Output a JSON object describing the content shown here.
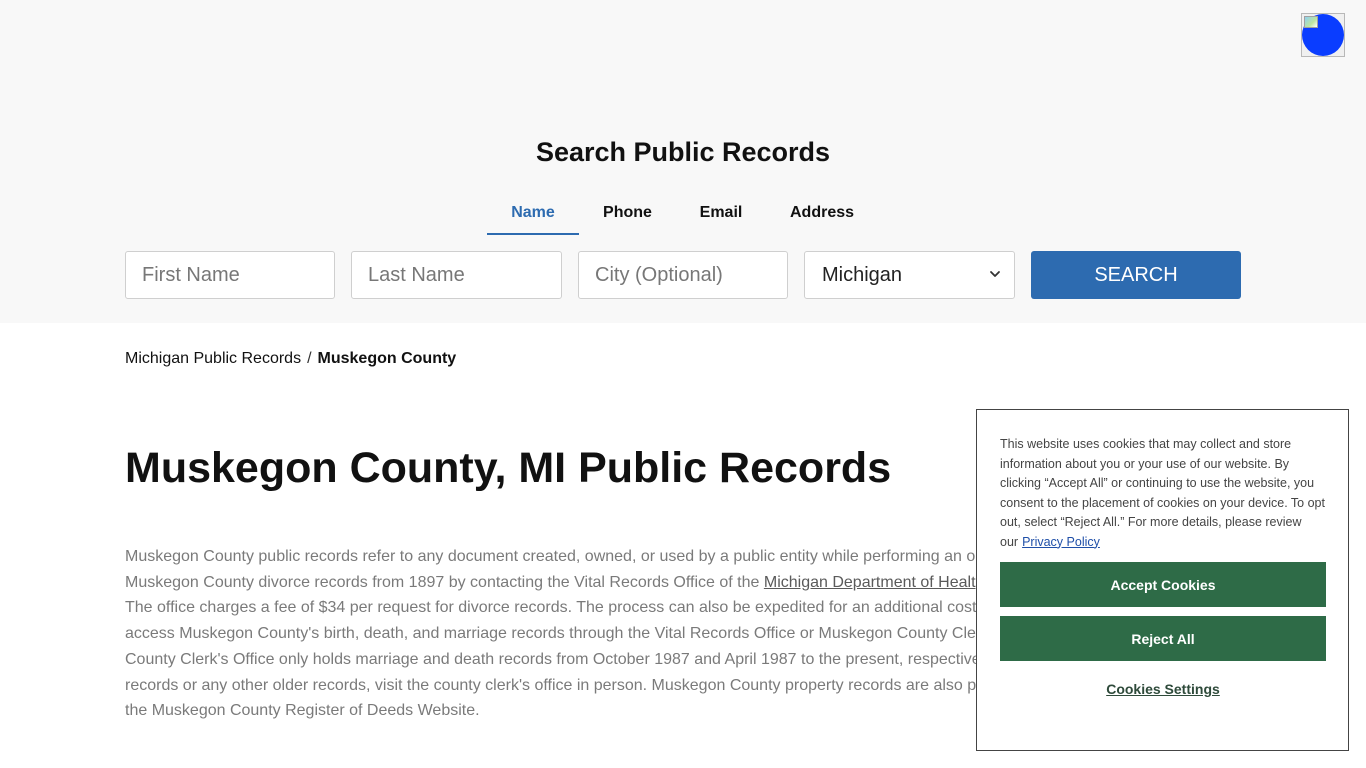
{
  "colors": {
    "accent": "#2d6bb0",
    "search_band": "#f8f8f8",
    "cookie_button": "#2e6b47",
    "avatar": "#0a3dff"
  },
  "search": {
    "title": "Search Public Records",
    "tabs": [
      {
        "label": "Name",
        "active": true
      },
      {
        "label": "Phone",
        "active": false
      },
      {
        "label": "Email",
        "active": false
      },
      {
        "label": "Address",
        "active": false
      }
    ],
    "first_name_placeholder": "First Name",
    "last_name_placeholder": "Last Name",
    "city_placeholder": "City (Optional)",
    "state_selected": "Michigan",
    "button_label": "SEARCH"
  },
  "breadcrumb": {
    "parent": "Michigan Public Records",
    "separator": "/",
    "current": "Muskegon County"
  },
  "page": {
    "title": "Muskegon County, MI Public Records",
    "lines": [
      {
        "text": "Muskegon County public records refer to any document created, owned, or used by a public entity while performing an o"
      },
      {
        "before": "Muskegon County divorce records from 1897 by contacting the Vital Records Office of the ",
        "link": "Michigan Department of Healt"
      },
      {
        "text": "The office charges a fee of $34 per request for divorce records. The process can also be expedited for an additional cost"
      },
      {
        "text": "access Muskegon County's birth, death, and marriage records through the Vital Records Office or Muskegon County Cle"
      },
      {
        "text": "County Clerk's Office only holds marriage and death records from October 1987 and April 1987 to the present, respective"
      },
      {
        "text": "records or any other older records, visit the county clerk's office in person. Muskegon County property records are also p"
      },
      {
        "text": "the Muskegon County Register of Deeds Website."
      }
    ]
  },
  "cookie": {
    "text": "This website uses cookies that may collect and store information about you or your use of our website. By clicking “Accept All” or continuing to use the website, you consent to the placement of cookies on your device. To opt out, select “Reject All.” For more details, please review our",
    "policy_link": "Privacy Policy",
    "accept_label": "Accept Cookies",
    "reject_label": "Reject All",
    "settings_label": "Cookies Settings"
  },
  "icons": {
    "avatar": "broken-image-avatar-icon",
    "select_chevron": "chevron-down-icon"
  }
}
